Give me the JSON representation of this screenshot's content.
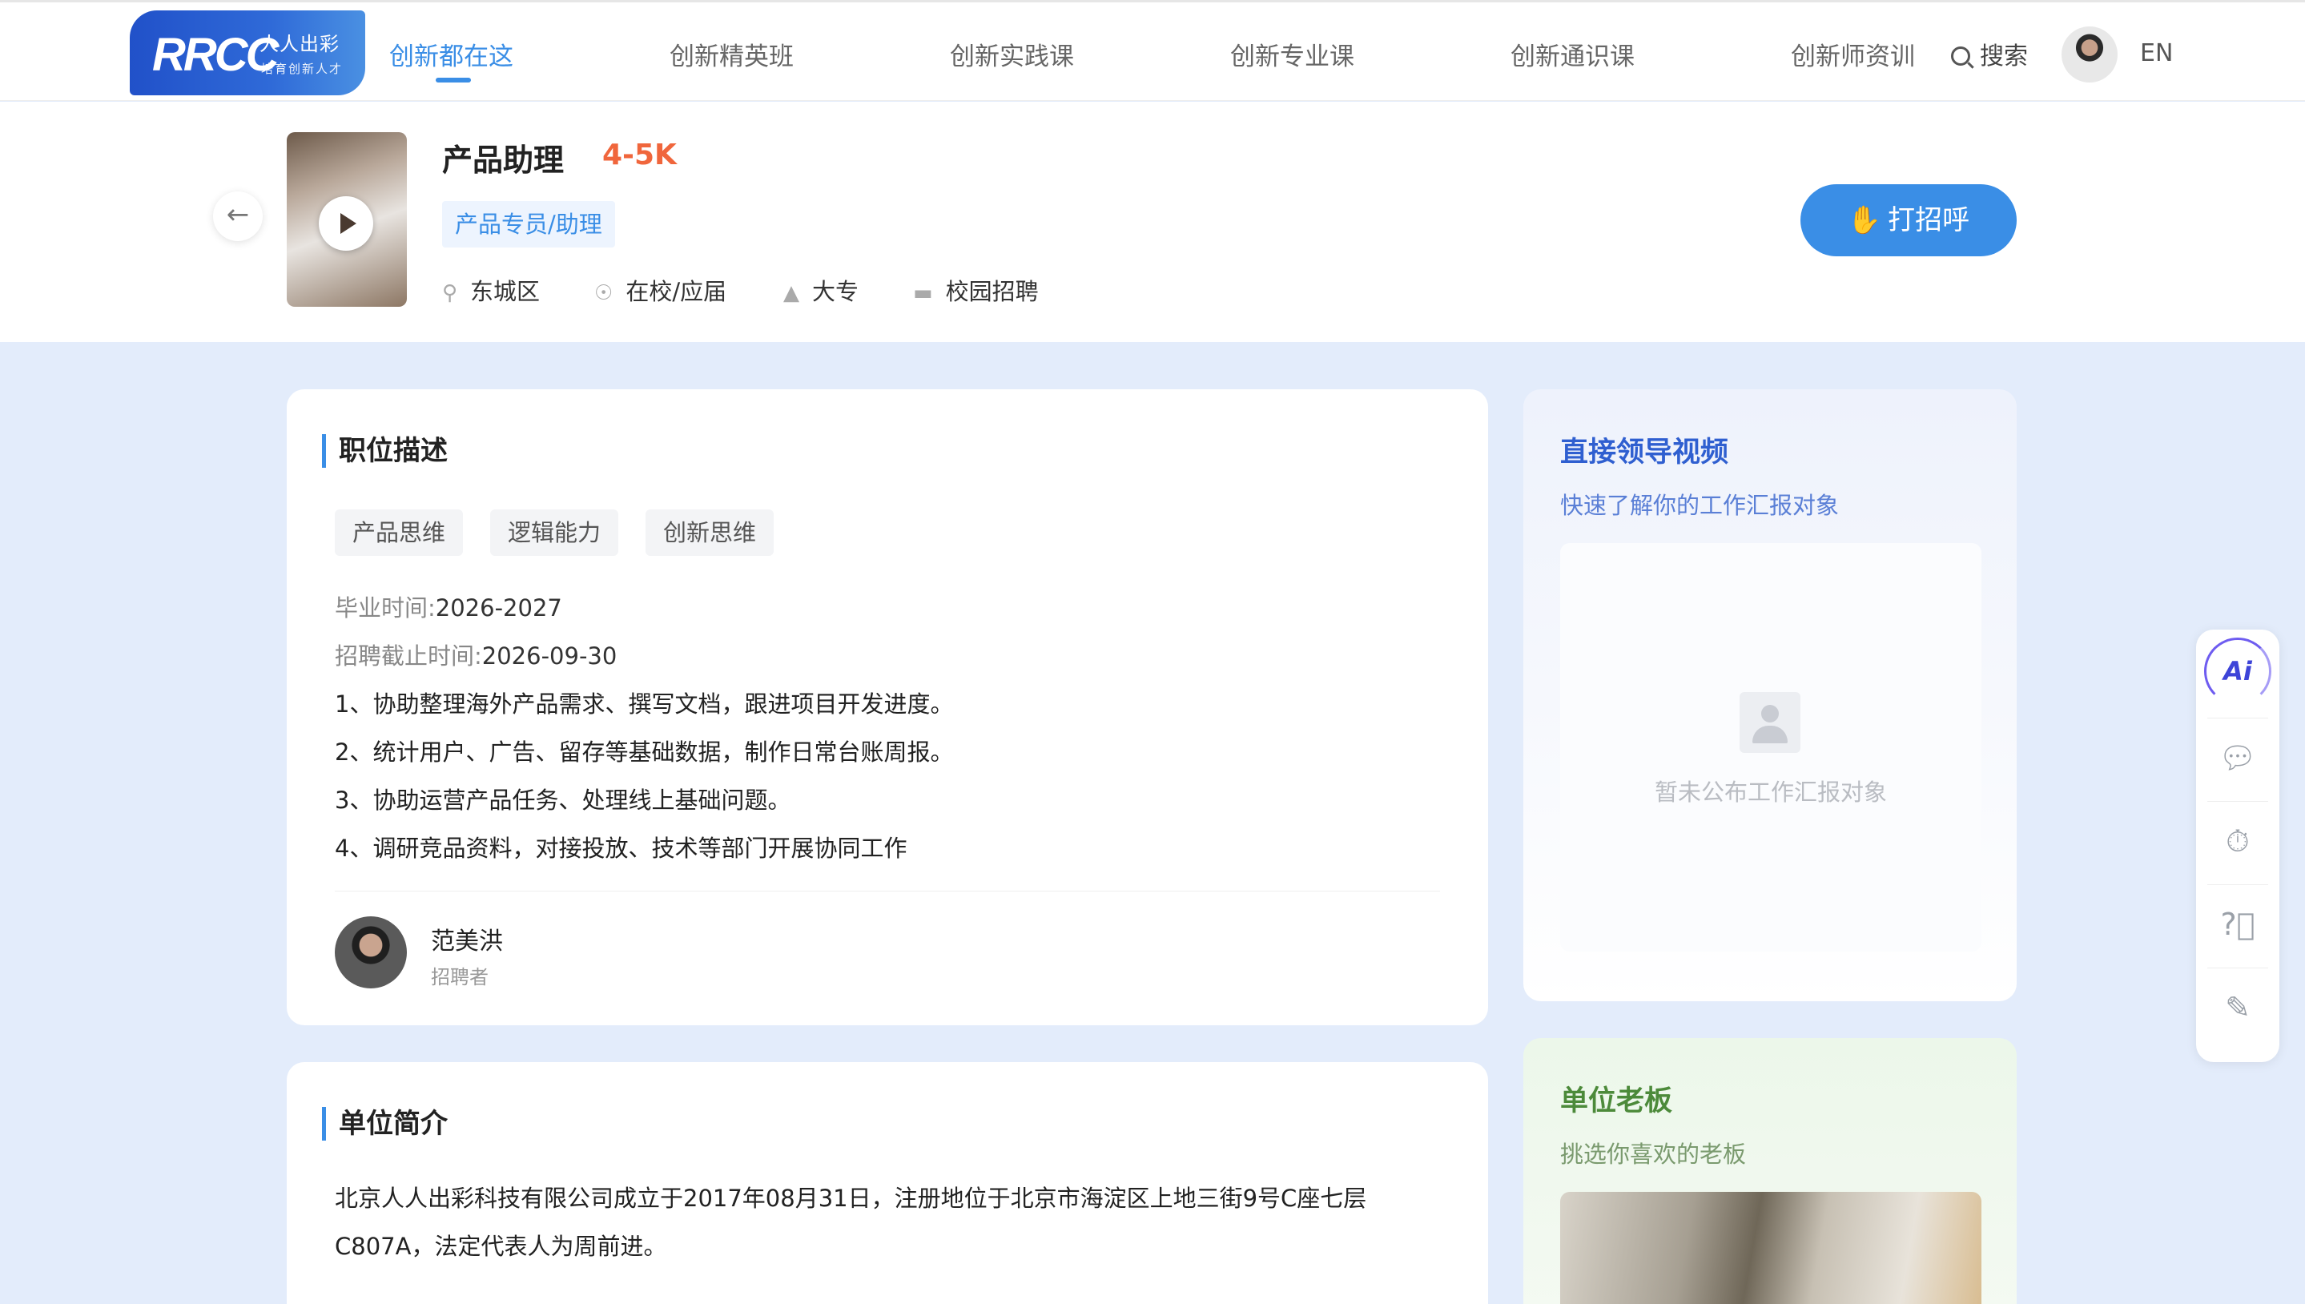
{
  "nav": {
    "logo_main": "RRCC",
    "logo_cn": "人人出彩",
    "logo_sub": "培育创新人才",
    "items": [
      "创新都在这",
      "创新精英班",
      "创新实践课",
      "创新专业课",
      "创新通识课",
      "创新师资训"
    ],
    "search_label": "搜索",
    "lang": "EN"
  },
  "job": {
    "title": "产品助理",
    "salary": "4-5K",
    "tag": "产品专员/助理",
    "meta": {
      "location": "东城区",
      "status": "在校/应届",
      "education": "大专",
      "type": "校园招聘"
    },
    "greet_label": "打招呼"
  },
  "description": {
    "title": "职位描述",
    "skills": [
      "产品思维",
      "逻辑能力",
      "创新思维"
    ],
    "grad_label": "毕业时间:",
    "grad_value": "2026-2027",
    "deadline_label": "招聘截止时间:",
    "deadline_value": "2026-09-30",
    "duties": [
      "1、协助整理海外产品需求、撰写文档，跟进项目开发进度。",
      "2、统计用户、广告、留存等基础数据，制作日常台账周报。",
      "3、协助运营产品任务、处理线上基础问题。",
      "4、调研竞品资料，对接投放、技术等部门开展协同工作"
    ],
    "recruiter_name": "范美洪",
    "recruiter_role": "招聘者"
  },
  "intro": {
    "title": "单位简介",
    "text": "北京人人出彩科技有限公司成立于2017年08月31日，注册地位于北京市海淀区上地三街9号C座七层C807A，法定代表人为周前进。"
  },
  "leader": {
    "title": "直接领导视频",
    "subtitle": "快速了解你的工作汇报对象",
    "empty_text": "暂未公布工作汇报对象",
    "title_color": "#2f5fd0",
    "subtitle_color": "#5a7fd6"
  },
  "boss": {
    "title": "单位老板",
    "subtitle": "挑选你喜欢的老板",
    "title_color": "#4c8a3a",
    "subtitle_color": "#7a9a6e"
  },
  "side_toolbar": {
    "ai_label": "Ai",
    "icons": [
      "chat-icon",
      "timer-icon",
      "help-icon",
      "edit-icon"
    ]
  },
  "colors": {
    "accent": "#3a8ee6",
    "salary": "#f0663c",
    "page_bg": "#e3ecfb"
  }
}
